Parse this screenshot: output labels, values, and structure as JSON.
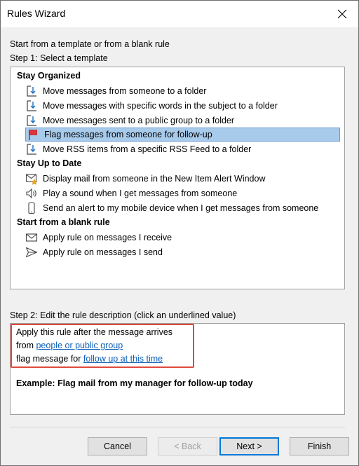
{
  "window": {
    "title": "Rules Wizard"
  },
  "header": {
    "intro": "Start from a template or from a blank rule",
    "step1": "Step 1: Select a template"
  },
  "templates": {
    "groups": [
      {
        "label": "Stay Organized"
      },
      {
        "label": "Stay Up to Date"
      },
      {
        "label": "Start from a blank rule"
      }
    ],
    "items": [
      {
        "label": "Move messages from someone to a folder",
        "icon": "move-folder-icon"
      },
      {
        "label": "Move messages with specific words in the subject to a folder",
        "icon": "move-folder-icon"
      },
      {
        "label": "Move messages sent to a public group to a folder",
        "icon": "move-folder-icon"
      },
      {
        "label": "Flag messages from someone for follow-up",
        "icon": "red-flag-icon",
        "selected": true
      },
      {
        "label": "Move RSS items from a specific RSS Feed to a folder",
        "icon": "move-folder-icon"
      },
      {
        "label": "Display mail from someone in the New Item Alert Window",
        "icon": "mail-alert-icon"
      },
      {
        "label": "Play a sound when I get messages from someone",
        "icon": "speaker-icon"
      },
      {
        "label": "Send an alert to my mobile device when I get messages from someone",
        "icon": "mobile-phone-icon"
      },
      {
        "label": "Apply rule on messages I receive",
        "icon": "envelope-icon"
      },
      {
        "label": "Apply rule on messages I send",
        "icon": "send-arrow-icon"
      }
    ]
  },
  "step2": {
    "label": "Step 2: Edit the rule description (click an underlined value)",
    "line1": "Apply this rule after the message arrives",
    "line2_prefix": "from ",
    "line2_link": "people or public group",
    "line3_prefix": "flag message for ",
    "line3_link": "follow up at this time",
    "example": "Example: Flag mail from my manager for follow-up today"
  },
  "buttons": {
    "cancel": "Cancel",
    "back": "< Back",
    "next": "Next >",
    "finish": "Finish"
  },
  "colors": {
    "selection": "#a9cbeb",
    "link": "#0c5eb8",
    "highlight_border": "#e04a3c",
    "default_button_border": "#0078d7"
  }
}
